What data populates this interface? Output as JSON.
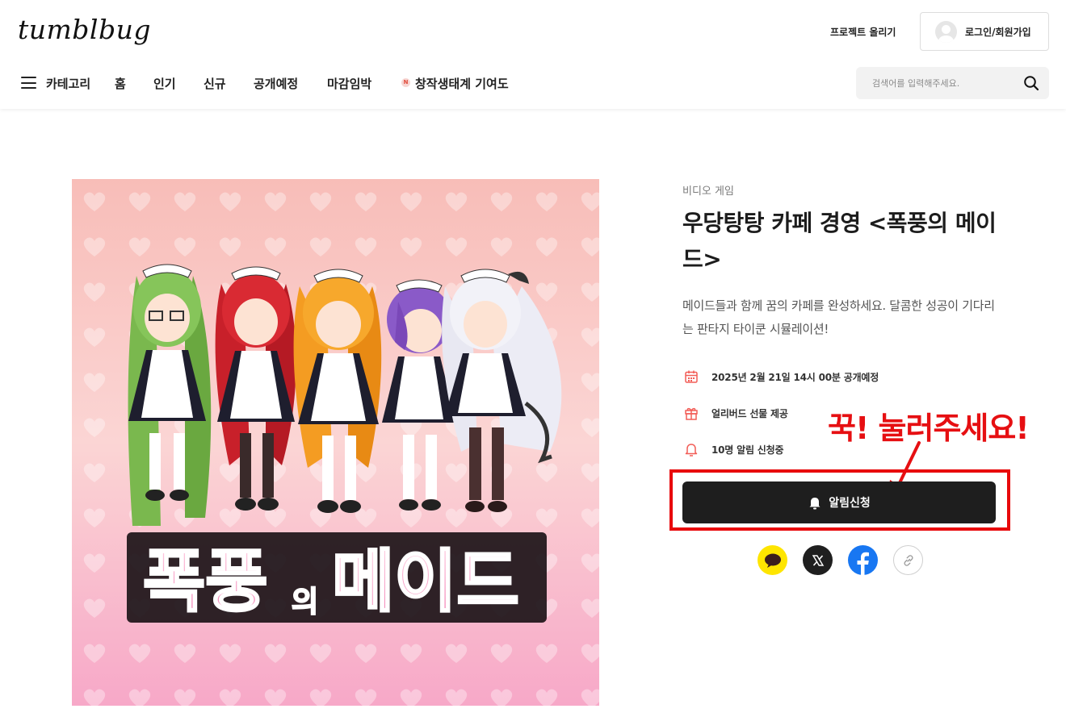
{
  "header": {
    "logo": "tumblbug",
    "project_upload": "프로젝트 올리기",
    "login": "로그인/회원가입",
    "nav": {
      "category": "카테고리",
      "items": [
        "홈",
        "인기",
        "신규",
        "공개예정",
        "마감임박"
      ],
      "special_badge": "N",
      "special": "창작생태계 기여도"
    },
    "search": {
      "placeholder": "검색어를 입력해주세요."
    }
  },
  "project": {
    "image": {
      "logo_part1": "폭풍",
      "logo_part2": "의",
      "logo_part3": "메이드"
    },
    "category": "비디오 게임",
    "title": "우당탕탕 카페 경영 <폭풍의 메이드>",
    "description": "메이드들과 함께 꿈의 카페를 완성하세요. 달콤한 성공이 기다리는 판타지 타이쿤 시뮬레이션!",
    "info": {
      "launch": "2025년 2월 21일 14시 00분 공개예정",
      "gift": "얼리버드 선물 제공",
      "alerts": "10명 알림 신청중"
    },
    "notify_button": "알림신청",
    "share": [
      "kakao-icon",
      "x-icon",
      "facebook-icon",
      "link-icon"
    ]
  },
  "annotation": {
    "text": "꾹! 눌러주세요!",
    "color": "#e60f12"
  }
}
